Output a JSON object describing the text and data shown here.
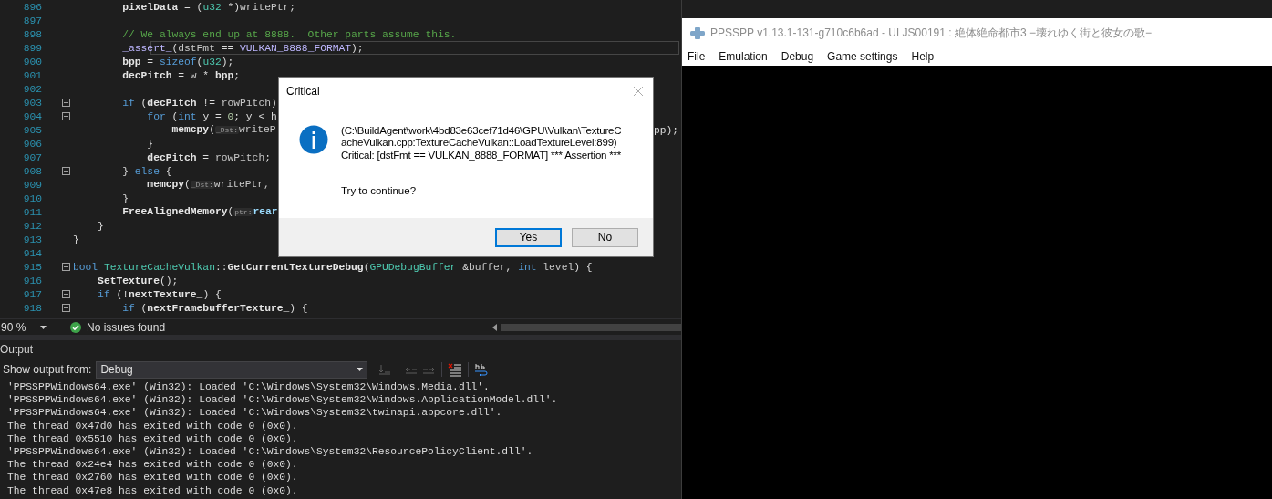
{
  "editor": {
    "lines": [
      {
        "number": "896",
        "current": false,
        "collapsible": false,
        "tokens": [
          {
            "kind": "member",
            "text": "        pixelData"
          },
          {
            "kind": "plain",
            "text": " = ("
          },
          {
            "kind": "type",
            "text": "u32"
          },
          {
            "kind": "plain",
            "text": " *)"
          },
          {
            "kind": "param",
            "text": "writePtr"
          },
          {
            "kind": "plain",
            "text": ";"
          }
        ]
      },
      {
        "number": "897",
        "current": false,
        "collapsible": false
      },
      {
        "number": "898",
        "current": false,
        "collapsible": false,
        "tokens": [
          {
            "kind": "comment",
            "text": "        // We always end up at 8888.  Other parts assume this."
          }
        ]
      },
      {
        "number": "899",
        "current": true,
        "collapsible": false,
        "tokens": [
          {
            "kind": "macro",
            "text": "        _assert_"
          },
          {
            "kind": "plain",
            "text": "("
          },
          {
            "kind": "param",
            "text": "dstFmt"
          },
          {
            "kind": "plain",
            "text": " == "
          },
          {
            "kind": "macro",
            "text": "VULKAN_8888_FORMAT"
          },
          {
            "kind": "plain",
            "text": ");"
          }
        ]
      },
      {
        "number": "900",
        "current": false,
        "collapsible": false,
        "tokens": [
          {
            "kind": "member",
            "text": "        bpp"
          },
          {
            "kind": "plain",
            "text": " = "
          },
          {
            "kind": "kw",
            "text": "sizeof"
          },
          {
            "kind": "plain",
            "text": "("
          },
          {
            "kind": "type",
            "text": "u32"
          },
          {
            "kind": "plain",
            "text": ");"
          }
        ]
      },
      {
        "number": "901",
        "current": false,
        "collapsible": false,
        "tokens": [
          {
            "kind": "member",
            "text": "        decPitch"
          },
          {
            "kind": "plain",
            "text": " = "
          },
          {
            "kind": "param",
            "text": "w"
          },
          {
            "kind": "plain",
            "text": " * "
          },
          {
            "kind": "member",
            "text": "bpp"
          },
          {
            "kind": "plain",
            "text": ";"
          }
        ]
      },
      {
        "number": "902",
        "current": false,
        "collapsible": false
      },
      {
        "number": "903",
        "current": false,
        "collapsible": true,
        "tokens": [
          {
            "kind": "kw",
            "text": "        if"
          },
          {
            "kind": "plain",
            "text": " ("
          },
          {
            "kind": "member",
            "text": "decPitch"
          },
          {
            "kind": "plain",
            "text": " != "
          },
          {
            "kind": "param",
            "text": "rowPitch"
          },
          {
            "kind": "plain",
            "text": ")"
          }
        ]
      },
      {
        "number": "904",
        "current": false,
        "collapsible": true,
        "tokens": [
          {
            "kind": "kw",
            "text": "            for"
          },
          {
            "kind": "plain",
            "text": " ("
          },
          {
            "kind": "kw",
            "text": "int"
          },
          {
            "kind": "plain",
            "text": " y = "
          },
          {
            "kind": "num",
            "text": "0"
          },
          {
            "kind": "plain",
            "text": "; y < h"
          }
        ]
      },
      {
        "number": "905",
        "current": false,
        "collapsible": false,
        "tokens": [
          {
            "kind": "fn",
            "text": "                memcpy"
          },
          {
            "kind": "plain",
            "text": "("
          },
          {
            "kind": "hint",
            "text": "_Dst:"
          },
          {
            "kind": "param",
            "text": "writeP"
          }
        ],
        "tail": "pp);"
      },
      {
        "number": "906",
        "current": false,
        "collapsible": false,
        "tokens": [
          {
            "kind": "plain",
            "text": "            }"
          }
        ]
      },
      {
        "number": "907",
        "current": false,
        "collapsible": false,
        "tokens": [
          {
            "kind": "member",
            "text": "            decPitch"
          },
          {
            "kind": "plain",
            "text": " = "
          },
          {
            "kind": "param",
            "text": "rowPitch"
          },
          {
            "kind": "plain",
            "text": ";"
          }
        ]
      },
      {
        "number": "908",
        "current": false,
        "collapsible": true,
        "tokens": [
          {
            "kind": "plain",
            "text": "        } "
          },
          {
            "kind": "kw",
            "text": "else"
          },
          {
            "kind": "plain",
            "text": " {"
          }
        ]
      },
      {
        "number": "909",
        "current": false,
        "collapsible": false,
        "tokens": [
          {
            "kind": "fn",
            "text": "            memcpy"
          },
          {
            "kind": "plain",
            "text": "("
          },
          {
            "kind": "hint",
            "text": "_Dst:"
          },
          {
            "kind": "param",
            "text": "writePtr,"
          }
        ]
      },
      {
        "number": "910",
        "current": false,
        "collapsible": false,
        "tokens": [
          {
            "kind": "plain",
            "text": "        }"
          }
        ]
      },
      {
        "number": "911",
        "current": false,
        "collapsible": false,
        "tokens": [
          {
            "kind": "fn",
            "text": "        FreeAlignedMemory"
          },
          {
            "kind": "plain",
            "text": "("
          },
          {
            "kind": "hint",
            "text": "ptr:"
          },
          {
            "kind": "var",
            "text": "rear"
          }
        ]
      },
      {
        "number": "912",
        "current": false,
        "collapsible": false,
        "tokens": [
          {
            "kind": "plain",
            "text": "    }"
          }
        ]
      },
      {
        "number": "913",
        "current": false,
        "collapsible": false,
        "tokens": [
          {
            "kind": "plain",
            "text": "}"
          }
        ]
      },
      {
        "number": "914",
        "current": false,
        "collapsible": false
      },
      {
        "number": "915",
        "current": false,
        "collapsible": true,
        "tokens": [
          {
            "kind": "kw",
            "text": "bool"
          },
          {
            "kind": "type",
            "text": " TextureCacheVulkan"
          },
          {
            "kind": "plain",
            "text": "::"
          },
          {
            "kind": "fn",
            "text": "GetCurrentTextureDebug"
          },
          {
            "kind": "plain",
            "text": "("
          },
          {
            "kind": "type",
            "text": "GPUDebugBuffer"
          },
          {
            "kind": "plain",
            "text": " &"
          },
          {
            "kind": "param",
            "text": "buffer"
          },
          {
            "kind": "plain",
            "text": ", "
          },
          {
            "kind": "kw",
            "text": "int"
          },
          {
            "kind": "param",
            "text": " level"
          },
          {
            "kind": "plain",
            "text": ") {"
          }
        ]
      },
      {
        "number": "916",
        "current": false,
        "collapsible": false,
        "tokens": [
          {
            "kind": "fn",
            "text": "    SetTexture"
          },
          {
            "kind": "plain",
            "text": "();"
          }
        ]
      },
      {
        "number": "917",
        "current": false,
        "collapsible": true,
        "tokens": [
          {
            "kind": "kw",
            "text": "    if"
          },
          {
            "kind": "plain",
            "text": " (!"
          },
          {
            "kind": "member",
            "text": "nextTexture_"
          },
          {
            "kind": "plain",
            "text": ") {"
          }
        ]
      },
      {
        "number": "918",
        "current": false,
        "collapsible": true,
        "tokens": [
          {
            "kind": "kw",
            "text": "        if"
          },
          {
            "kind": "plain",
            "text": " ("
          },
          {
            "kind": "member",
            "text": "nextFramebufferTexture_"
          },
          {
            "kind": "plain",
            "text": ") {"
          }
        ]
      }
    ]
  },
  "status_bar": {
    "zoom": "90 %",
    "issues": "No issues found"
  },
  "output": {
    "title": "Output",
    "source_label": "Show output from:",
    "source": "Debug",
    "lines": [
      "'PPSSPPWindows64.exe' (Win32): Loaded 'C:\\Windows\\System32\\Windows.Media.dll'.",
      "'PPSSPPWindows64.exe' (Win32): Loaded 'C:\\Windows\\System32\\Windows.ApplicationModel.dll'.",
      "'PPSSPPWindows64.exe' (Win32): Loaded 'C:\\Windows\\System32\\twinapi.appcore.dll'.",
      "The thread 0x47d0 has exited with code 0 (0x0).",
      "The thread 0x5510 has exited with code 0 (0x0).",
      "'PPSSPPWindows64.exe' (Win32): Loaded 'C:\\Windows\\System32\\ResourcePolicyClient.dll'.",
      "The thread 0x24e4 has exited with code 0 (0x0).",
      "The thread 0x2760 has exited with code 0 (0x0).",
      "The thread 0x47e8 has exited with code 0 (0x0)."
    ]
  },
  "dialog": {
    "title": "Critical",
    "message_lines": [
      "(C:\\BuildAgent\\work\\4bd83e63cef71d46\\GPU\\Vulkan\\TextureC",
      "acheVulkan.cpp:TextureCacheVulkan::LoadTextureLevel:899)",
      "Critical: [dstFmt == VULKAN_8888_FORMAT] *** Assertion ***"
    ],
    "question": "Try to continue?",
    "buttons": [
      {
        "label": "Yes",
        "selected": true
      },
      {
        "label": "No",
        "selected": false
      }
    ]
  },
  "emulator": {
    "title": "PPSSPP v1.13.1-131-g710c6b6ad - ULJS00191 : 絶体絶命都市3 −壊れゆく街と彼女の歌−",
    "menu": [
      "File",
      "Emulation",
      "Debug",
      "Game settings",
      "Help"
    ]
  }
}
